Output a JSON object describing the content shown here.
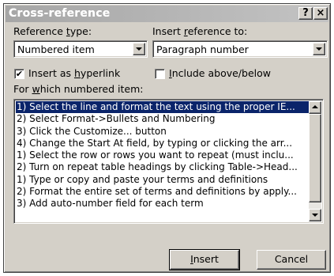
{
  "window": {
    "title": "Cross-reference",
    "help_label": "?",
    "close_label": "×"
  },
  "reference_type": {
    "label_pre": "Reference ",
    "label_key": "t",
    "label_post": "ype:",
    "value": "Numbered item"
  },
  "insert_reference_to": {
    "label_pre": "Insert ",
    "label_key": "r",
    "label_post": "eference to:",
    "value": "Paragraph number"
  },
  "insert_as_hyperlink": {
    "label_pre": "Insert as ",
    "label_key": "h",
    "label_post": "yperlink",
    "checked": true,
    "check_glyph": "✔"
  },
  "include_above_below": {
    "label_pre": "",
    "label_key": "I",
    "label_post": "nclude above/below",
    "checked": false
  },
  "list": {
    "label_pre": "For ",
    "label_key": "w",
    "label_post": "hich numbered item:",
    "items": [
      "1) Select the line and format the text using the proper IE...",
      "2) Select Format->Bullets and Numbering",
      "3) Click the Customize... button",
      "4) Change the Start At field, by typing or clicking the arr...",
      "1) Select the row or rows you want to repeat (must inclu...",
      "2) Turn on repeat table headings by clicking Table->Head...",
      "1) Type or copy and paste your terms and definitions",
      "2) Format the entire set of terms and definitions by apply...",
      "3) Add auto-number field for each term"
    ],
    "selected_index": 0
  },
  "buttons": {
    "insert_key": "I",
    "insert_rest": "nsert",
    "cancel": "Cancel"
  },
  "colors": {
    "selection": "#0a246a",
    "face": "#d4d0c8"
  }
}
